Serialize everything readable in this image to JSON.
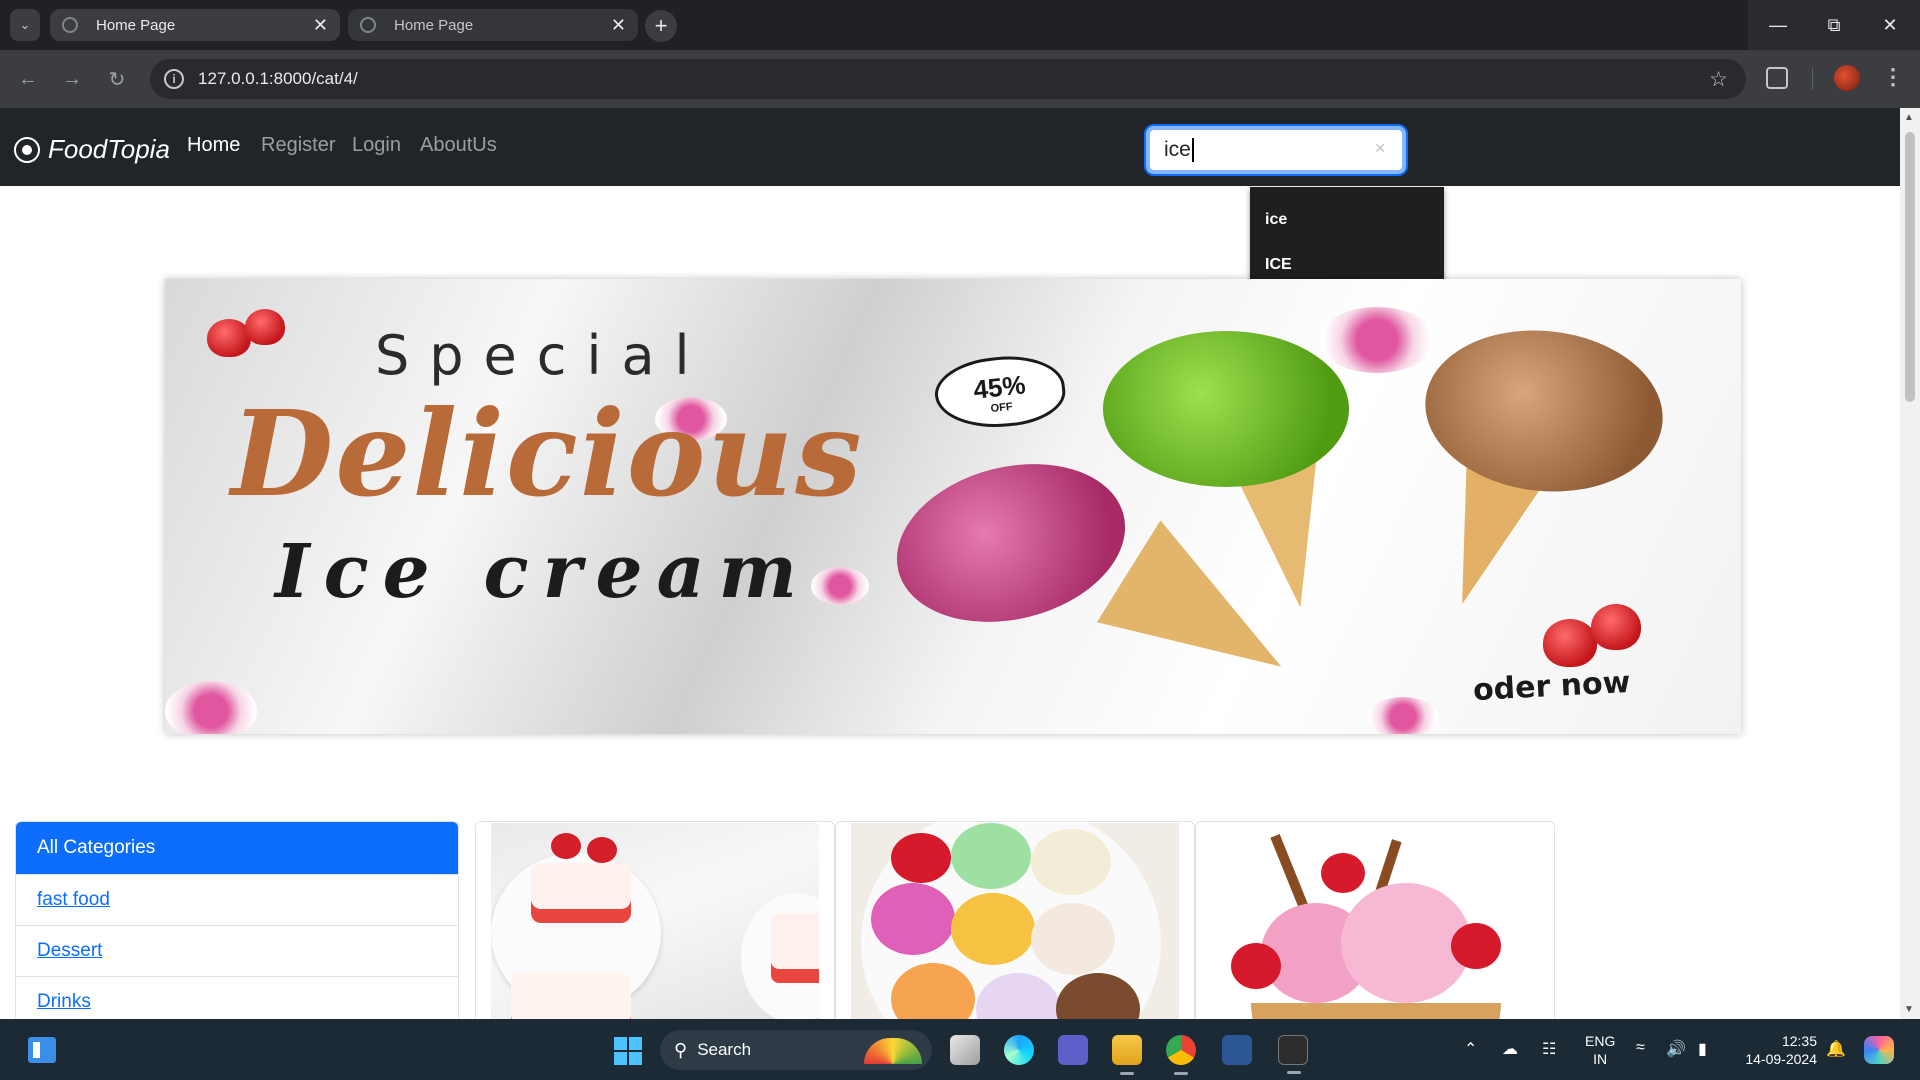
{
  "browser": {
    "tabs": [
      {
        "title": "Home Page",
        "active": true
      },
      {
        "title": "Home Page",
        "active": false
      }
    ],
    "url": "127.0.0.1:8000/cat/4/"
  },
  "site": {
    "brand": "FoodTopia",
    "nav": [
      {
        "label": "Home",
        "active": true
      },
      {
        "label": "Register",
        "active": false
      },
      {
        "label": "Login",
        "active": false
      },
      {
        "label": "AboutUs",
        "active": false
      }
    ],
    "search": {
      "value": "ice"
    },
    "autocomplete": [
      "ice",
      "ICE"
    ]
  },
  "banner": {
    "line1": "Special",
    "line2": "Delicious",
    "line3": "Ice cream",
    "badge_pct": "45%",
    "badge_off": "OFF",
    "cta": "oder now"
  },
  "categories": {
    "header": "All Categories",
    "items": [
      "fast food",
      "Dessert",
      "Drinks"
    ]
  },
  "taskbar": {
    "search_label": "Search",
    "lang_top": "ENG",
    "lang_bottom": "IN",
    "time": "12:35",
    "date": "14-09-2024"
  },
  "colors": {
    "primary": "#0d6efd",
    "navbar": "#212529",
    "link": "#0d6efd"
  }
}
